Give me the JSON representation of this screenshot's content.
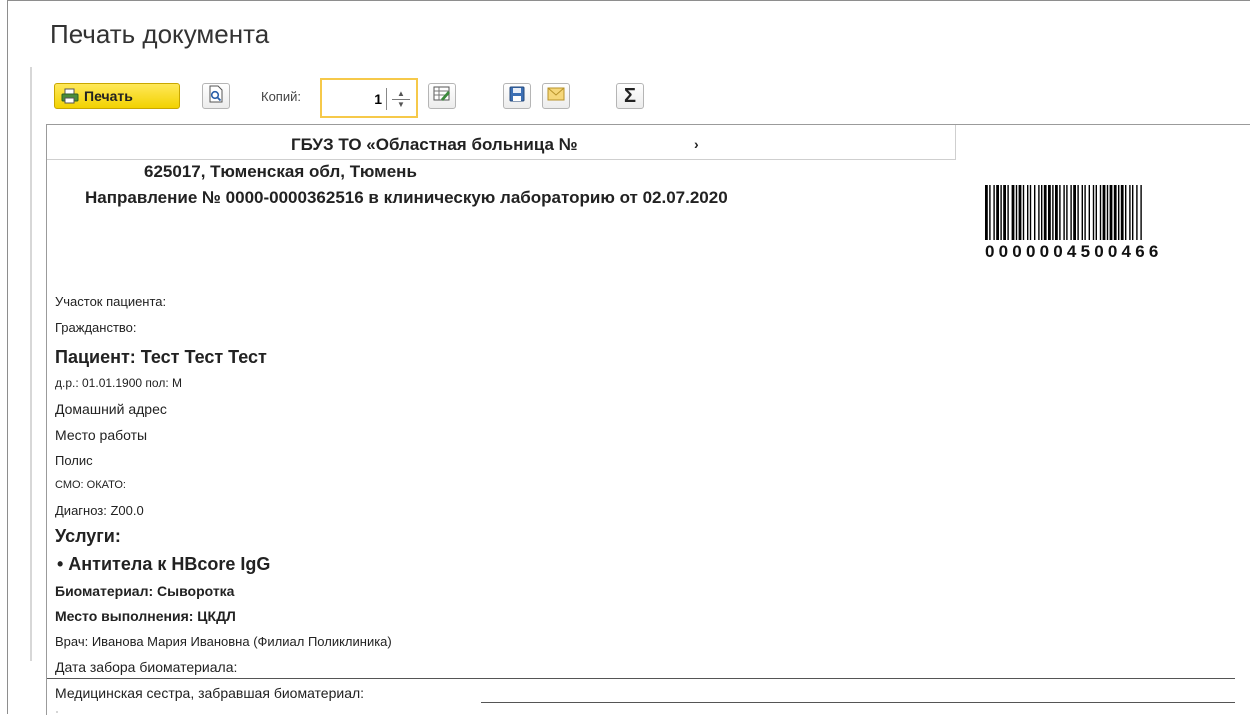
{
  "window": {
    "title": "Печать документа"
  },
  "toolbar": {
    "print_label": "Печать",
    "copies_label": "Копий:",
    "copies_value": "1"
  },
  "document": {
    "org_name": "ГБУЗ ТО «Областная больница №",
    "org_suffix": "›",
    "address": "625017, Тюменская обл, Тюмень",
    "referral_title": "Направление № 0000-0000362516 в клиническую лабораторию от 02.07.2020",
    "barcode_number": "0000004500466",
    "patient_area": "Участок пациента:",
    "citizenship": "Гражданство:",
    "patient": "Пациент: Тест Тест Тест",
    "birth_sex": "д.р.: 01.01.1900 пол: М",
    "home_address": "Домашний адрес",
    "workplace": "Место работы",
    "policy": "Полис",
    "smo_okato": "СМО:  ОКАТО:",
    "diagnosis": "Диагноз: Z00.0",
    "services_heading": "Услуги:",
    "service_item": "• Антитела к HBcore IgG",
    "biomaterial": "Биоматериал: Сыворотка",
    "execution_place": "Место выполнения:   ЦКДЛ",
    "doctor": "Врач: Иванова Мария Ивановна (Филиал Поликлиника)",
    "collection_date": "Дата забора биоматериала:",
    "nurse": "Медицинская сестра, забравшая биоматериал:"
  }
}
